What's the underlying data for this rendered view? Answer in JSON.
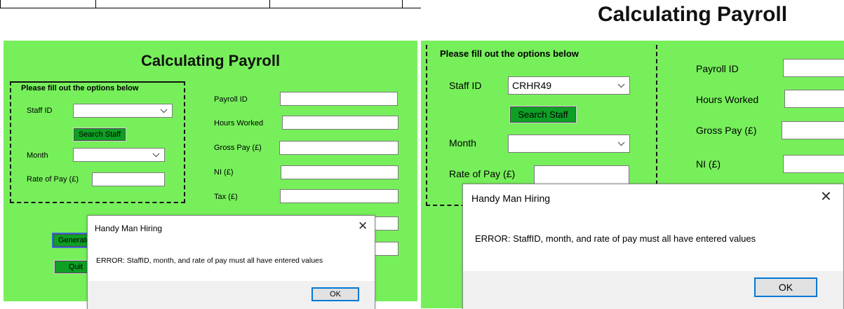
{
  "left": {
    "title": "Calculating Payroll",
    "group_label": "Please fill out the options below",
    "staff_id_label": "Staff ID",
    "staff_id_value": "",
    "search_button": "Search Staff",
    "month_label": "Month",
    "month_value": "",
    "rate_label": "Rate of Pay (£)",
    "rate_value": "",
    "payroll_id_label": "Payroll ID",
    "hours_label": "Hours Worked",
    "gross_label": "Gross Pay (£)",
    "ni_label": "NI (£)",
    "tax_label": "Tax (£)",
    "generate_button": "Generate",
    "quit_button": "Quit",
    "dialog": {
      "title": "Handy Man Hiring",
      "message": "ERROR: StaffID, month, and rate of pay must all have entered values",
      "ok": "OK"
    }
  },
  "right": {
    "title": "Calculating Payroll",
    "group_label": "Please fill out the options below",
    "staff_id_label": "Staff ID",
    "staff_id_value": "CRHR49",
    "search_button": "Search Staff",
    "month_label": "Month",
    "month_value": "",
    "rate_label": "Rate of Pay (£)",
    "payroll_id_label": "Payroll ID",
    "hours_label": "Hours Worked",
    "gross_label": "Gross Pay (£)",
    "ni_label": "NI (£)",
    "dialog": {
      "title": "Handy Man Hiring",
      "message": "ERROR: StaffID, month, and rate of pay must all have entered values",
      "ok": "OK"
    }
  },
  "colors": {
    "background": "#77ef5b",
    "button": "#0e9f25",
    "dialog_footer": "#f0f0f0"
  }
}
